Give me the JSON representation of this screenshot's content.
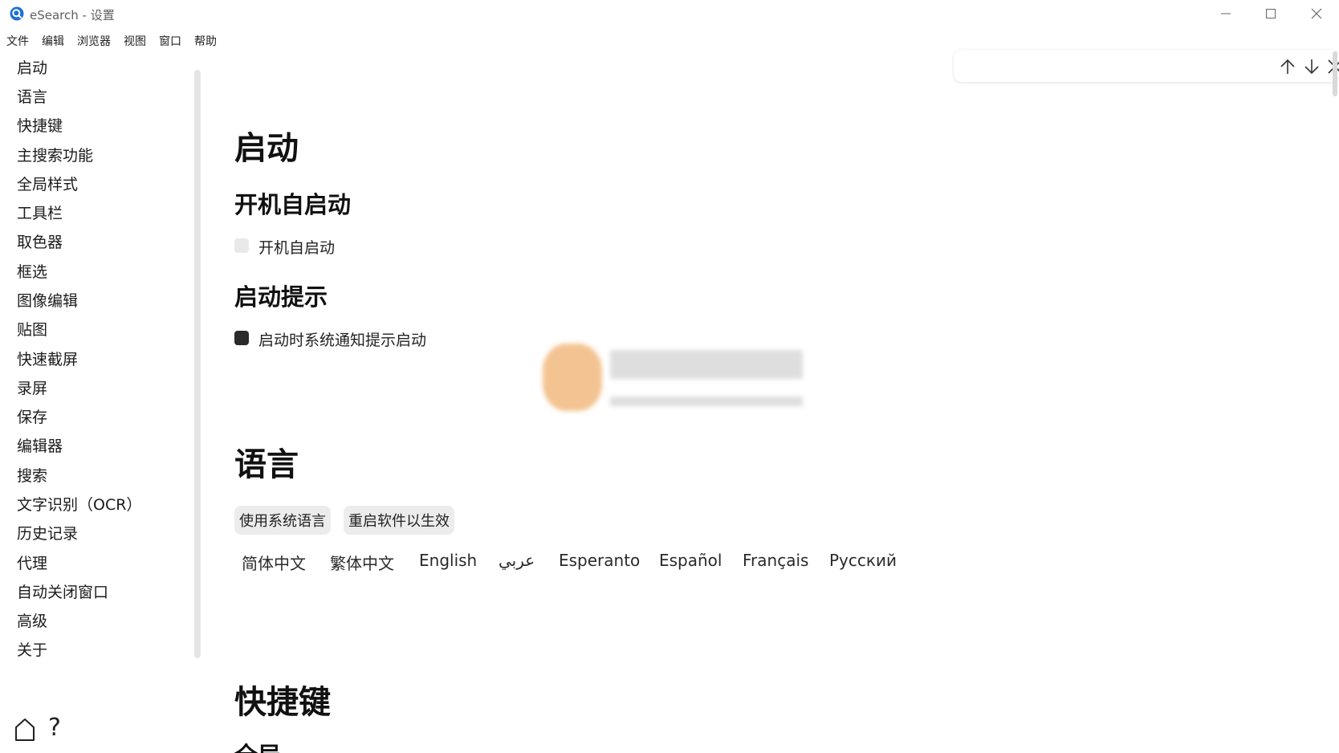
{
  "window": {
    "title": "eSearch - 设置",
    "accent_color": "#1e6fd9"
  },
  "menubar": {
    "items": [
      "文件",
      "编辑",
      "浏览器",
      "视图",
      "窗口",
      "帮助"
    ]
  },
  "sidebar": {
    "items": [
      "启动",
      "语言",
      "快捷键",
      "主搜索功能",
      "全局样式",
      "工具栏",
      "取色器",
      "框选",
      "图像编辑",
      "贴图",
      "快速截屏",
      "录屏",
      "保存",
      "编辑器",
      "搜索",
      "文字识别（OCR）",
      "历史记录",
      "代理",
      "自动关闭窗口",
      "高级",
      "关于"
    ],
    "bottom_icons": [
      "home-icon",
      "help-icon"
    ],
    "help_glyph": "?"
  },
  "findbar": {
    "icons": [
      "arrow-up-icon",
      "arrow-down-icon",
      "close-icon"
    ]
  },
  "content": {
    "startup": {
      "heading": "启动",
      "autostart": {
        "heading": "开机自启动",
        "checkbox_label": "开机自启动",
        "checked": false
      },
      "notify": {
        "heading": "启动提示",
        "checkbox_label": "启动时系统通知提示启动",
        "checked": true
      }
    },
    "language": {
      "heading": "语言",
      "buttons": [
        "使用系统语言",
        "重启软件以生效"
      ],
      "options": [
        "简体中文",
        "繁体中文",
        "English",
        "عربي",
        "Esperanto",
        "Español",
        "Français",
        "Русский"
      ]
    },
    "shortcuts": {
      "heading": "快捷键",
      "subheading": "全局"
    }
  }
}
